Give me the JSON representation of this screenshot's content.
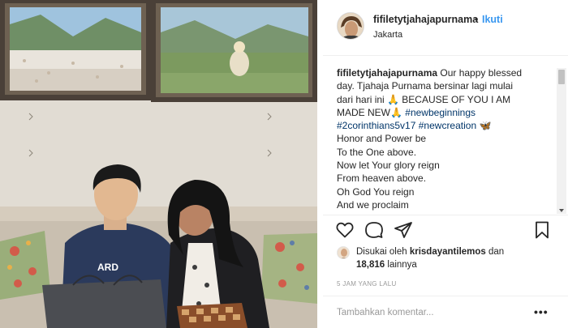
{
  "post": {
    "username": "fifiletytjahajapurnama",
    "separator": "•",
    "follow_label": "Ikuti",
    "location": "Jakarta"
  },
  "caption": {
    "username": "fifiletytjahajapurnama",
    "line1_text": " Our happy blessed",
    "line2": "day. Tjahaja Purnama bersinar lagi mulai",
    "line3": "dari hari ini 🙏 BECAUSE OF YOU I AM",
    "line4_text": "MADE NEW🙏 ",
    "line4_tag": "#newbeginnings",
    "line5_tag1": "#2corinthians5v17",
    "line5_sep": " ",
    "line5_tag2": "#newcreation",
    "line5_emoji": " 🦋",
    "line6": "Honor and Power be",
    "line7": "To the One above.",
    "line8": "Now let Your glory reign",
    "line9": "From heaven above.",
    "line10": "Oh God You reign",
    "line11": "And we proclaim"
  },
  "actions": {
    "like_icon": "heart-icon",
    "comment_icon": "speech-bubble-icon",
    "share_icon": "paper-plane-icon",
    "save_icon": "bookmark-icon"
  },
  "likes": {
    "prefix": "Disukai oleh ",
    "user": "krisdayantilemos",
    "middle": " dan",
    "count": "18,816",
    "suffix": " lainnya"
  },
  "timestamp": "5 JAM YANG LALU",
  "comment": {
    "placeholder": "Tambahkan komentar...",
    "more_label": "•••"
  },
  "colors": {
    "link_blue": "#3897f0",
    "hashtag": "#003569",
    "muted": "#999999",
    "text": "#262626"
  }
}
